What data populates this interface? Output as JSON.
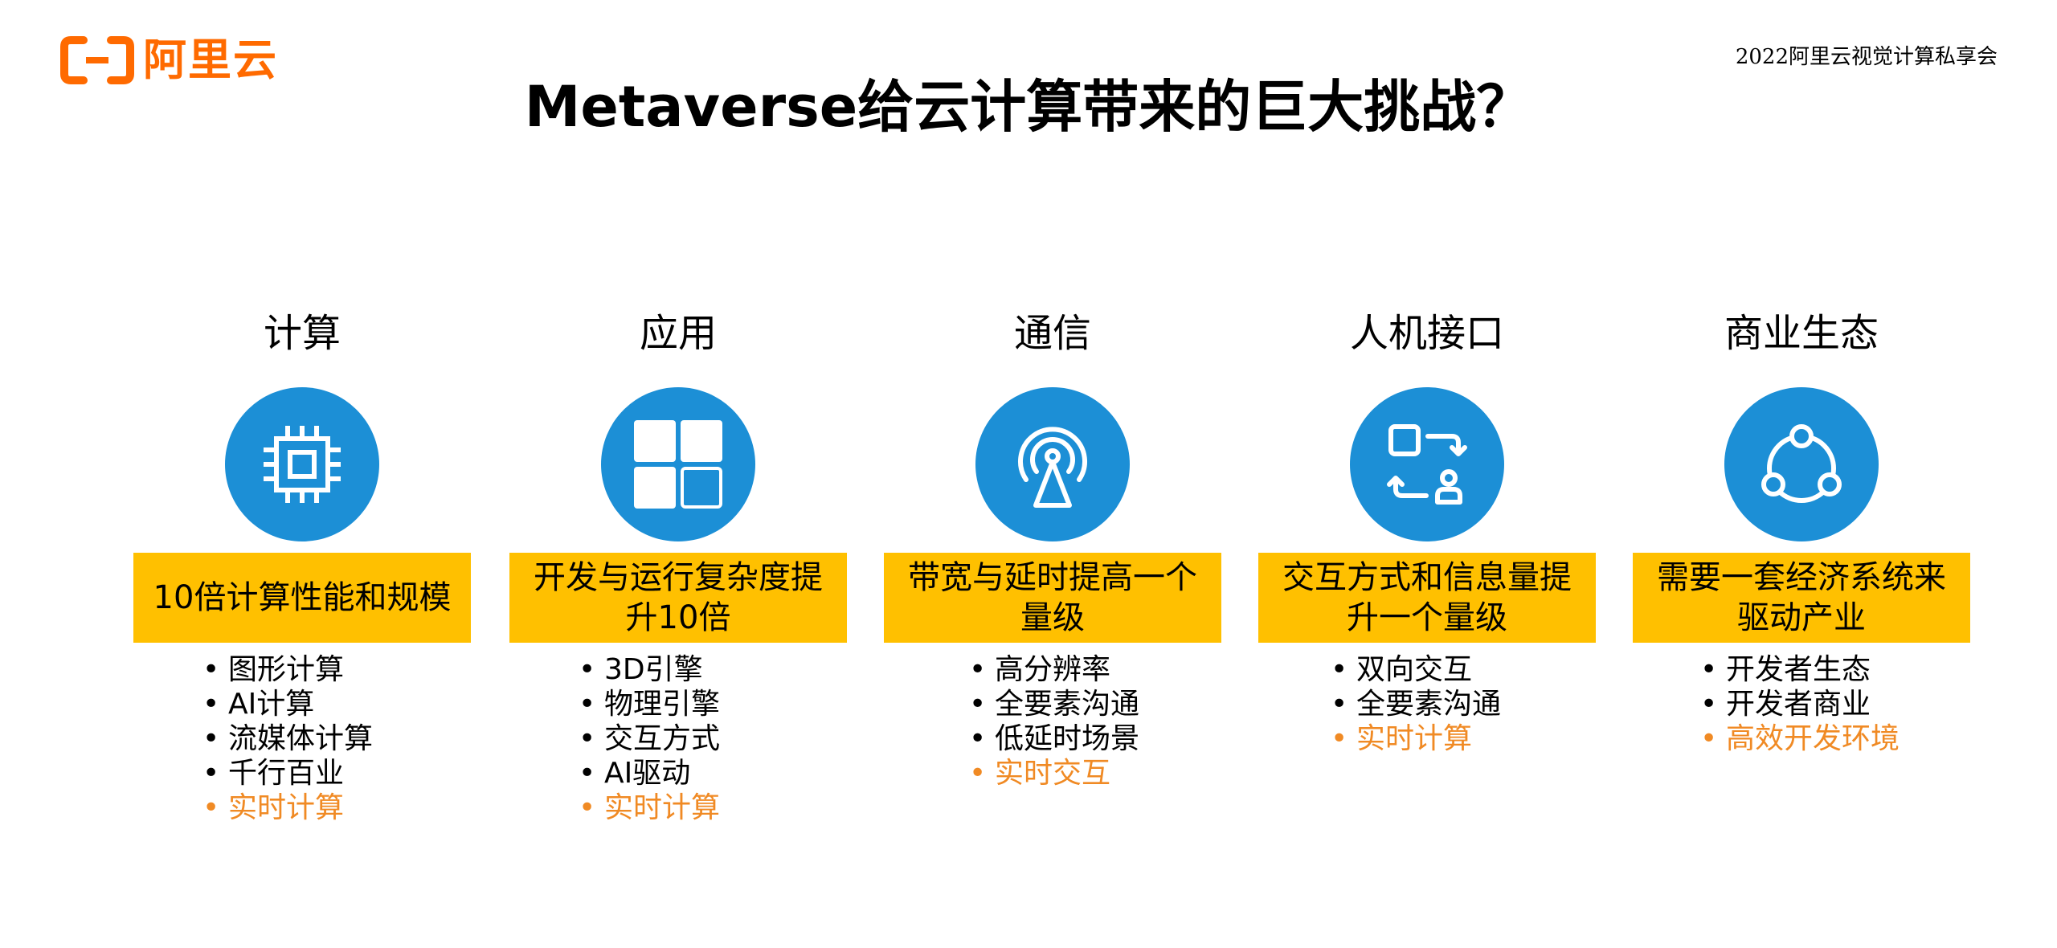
{
  "logo": {
    "text": "阿里云",
    "brand_color": "#ff6a00"
  },
  "event": "2022阿里云视觉计算私享会",
  "title": "Metaverse给云计算带来的巨大挑战？",
  "colors": {
    "circle": "#1c8fd6",
    "box": "#ffc000",
    "highlight": "#f08a24"
  },
  "columns": [
    {
      "heading": "计算",
      "icon": "cpu-chip-icon",
      "box": "10倍计算性能和规模",
      "bullets": [
        {
          "text": "图形计算",
          "highlight": false
        },
        {
          "text": "AI计算",
          "highlight": false
        },
        {
          "text": "流媒体计算",
          "highlight": false
        },
        {
          "text": "千行百业",
          "highlight": false
        },
        {
          "text": "实时计算",
          "highlight": true
        }
      ]
    },
    {
      "heading": "应用",
      "icon": "app-grid-icon",
      "box": "开发与运行复杂度提升10倍",
      "bullets": [
        {
          "text": "3D引擎",
          "highlight": false
        },
        {
          "text": "物理引擎",
          "highlight": false
        },
        {
          "text": "交互方式",
          "highlight": false
        },
        {
          "text": "AI驱动",
          "highlight": false
        },
        {
          "text": "实时计算",
          "highlight": true
        }
      ]
    },
    {
      "heading": "通信",
      "icon": "broadcast-antenna-icon",
      "box": "带宽与延时提高一个量级",
      "bullets": [
        {
          "text": "高分辨率",
          "highlight": false
        },
        {
          "text": "全要素沟通",
          "highlight": false
        },
        {
          "text": "低延时场景",
          "highlight": false
        },
        {
          "text": "实时交互",
          "highlight": true
        }
      ]
    },
    {
      "heading": "人机接口",
      "icon": "human-machine-exchange-icon",
      "box": "交互方式和信息量提升一个量级",
      "bullets": [
        {
          "text": "双向交互",
          "highlight": false
        },
        {
          "text": "全要素沟通",
          "highlight": false
        },
        {
          "text": "实时计算",
          "highlight": true
        }
      ]
    },
    {
      "heading": "商业生态",
      "icon": "share-network-icon",
      "box": "需要一套经济系统来驱动产业",
      "bullets": [
        {
          "text": "开发者生态",
          "highlight": false
        },
        {
          "text": "开发者商业",
          "highlight": false
        },
        {
          "text": "高效开发环境",
          "highlight": true
        }
      ]
    }
  ]
}
